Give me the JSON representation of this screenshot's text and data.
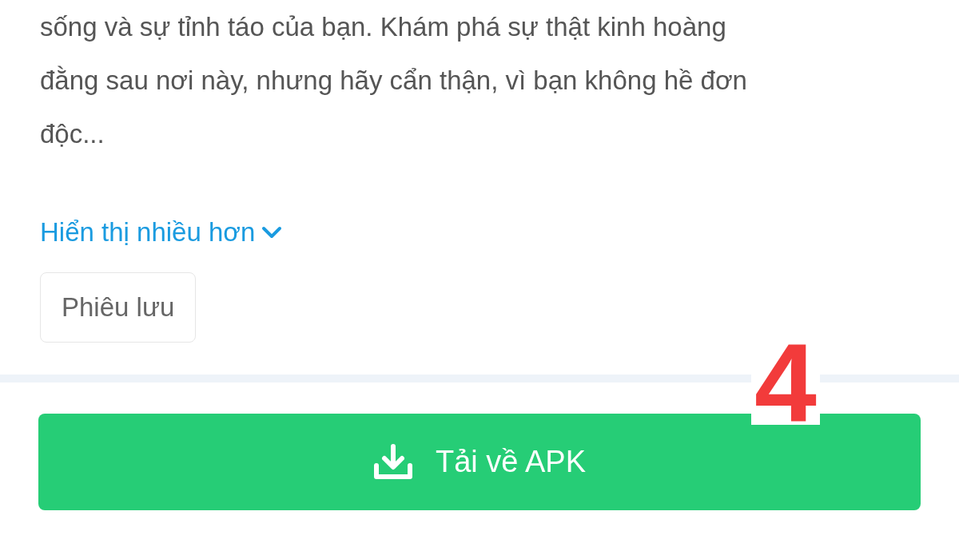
{
  "description": {
    "lines": [
      "sống và sự tỉnh táo của bạn. Khám phá sự thật kinh hoàng",
      "đằng sau nơi này, nhưng hãy cẩn thận, vì bạn không hề đơn",
      "độc..."
    ]
  },
  "show_more": {
    "label": "Hiển thị nhiều hơn",
    "expanded": false
  },
  "tags": [
    "Phiêu lưu"
  ],
  "step_marker": "4",
  "download_button": {
    "label": "Tải về APK"
  }
}
